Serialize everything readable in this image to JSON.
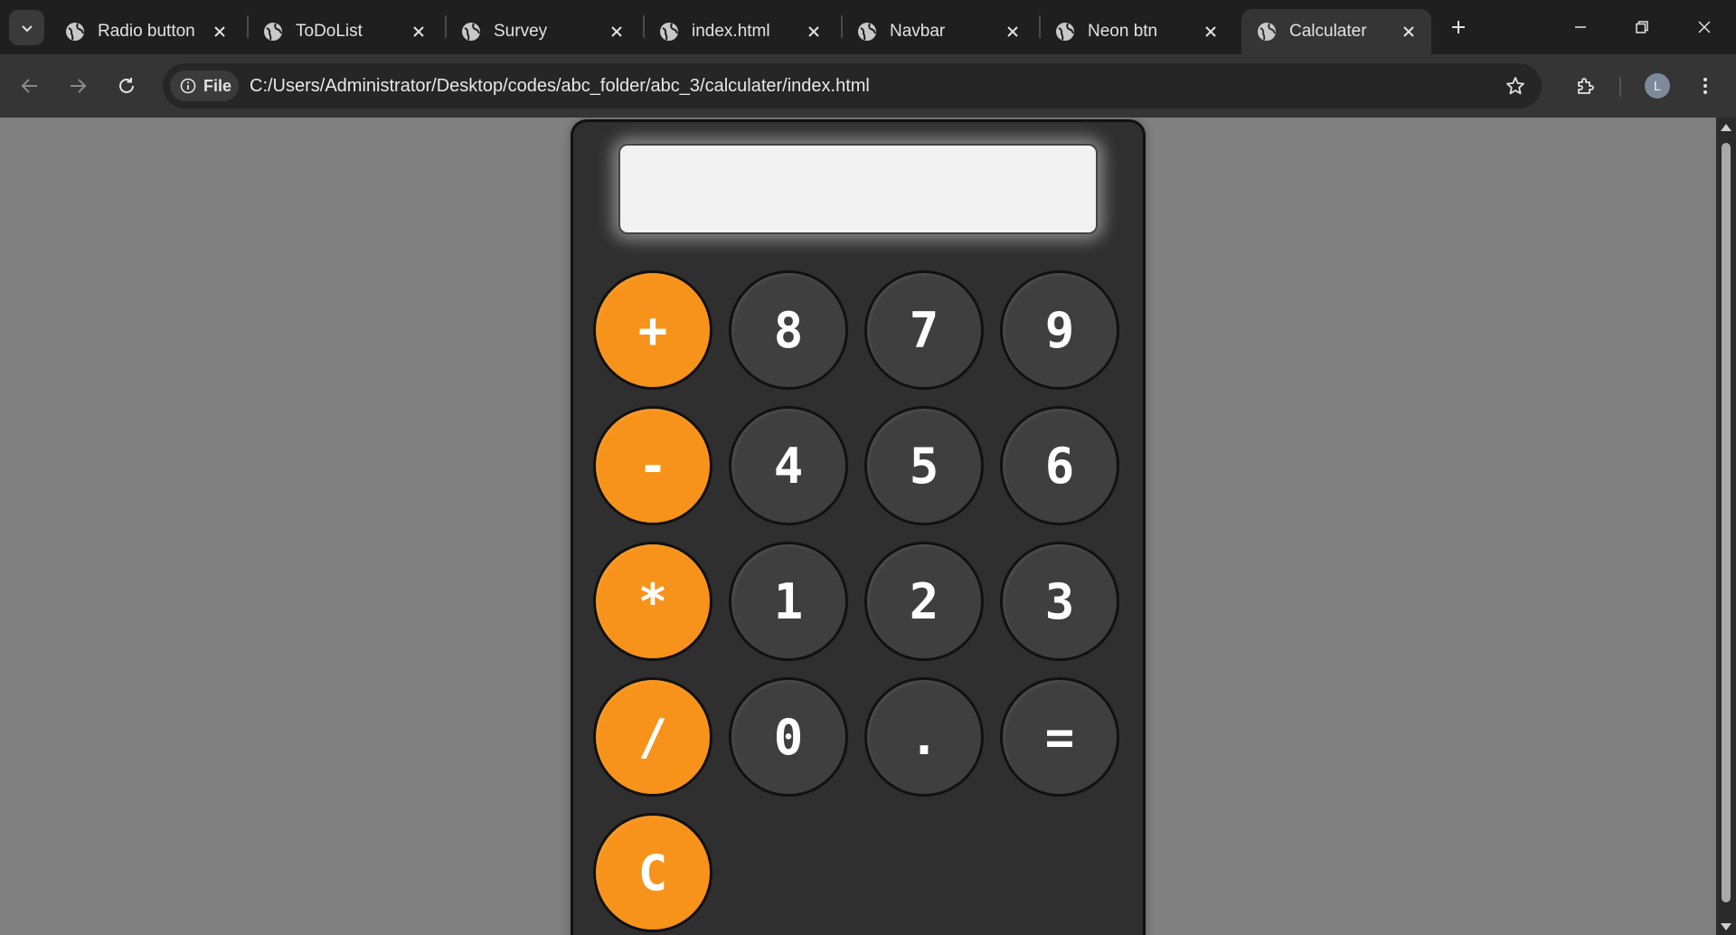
{
  "browser": {
    "tabs": [
      {
        "title": "Radio button",
        "active": false
      },
      {
        "title": "ToDoList",
        "active": false
      },
      {
        "title": "Survey",
        "active": false
      },
      {
        "title": "index.html",
        "active": false
      },
      {
        "title": "Navbar",
        "active": false
      },
      {
        "title": "Neon btn",
        "active": false
      },
      {
        "title": "Calculater",
        "active": true
      }
    ],
    "omnibox": {
      "scheme_chip": "File",
      "url": "C:/Users/Administrator/Desktop/codes/abc_folder/abc_3/calculater/index.html"
    },
    "profile_initial": "L"
  },
  "calculator": {
    "display_value": "",
    "keys": [
      {
        "label": "+",
        "kind": "operator"
      },
      {
        "label": "8",
        "kind": "digit"
      },
      {
        "label": "7",
        "kind": "digit"
      },
      {
        "label": "9",
        "kind": "digit"
      },
      {
        "label": "-",
        "kind": "operator"
      },
      {
        "label": "4",
        "kind": "digit"
      },
      {
        "label": "5",
        "kind": "digit"
      },
      {
        "label": "6",
        "kind": "digit"
      },
      {
        "label": "*",
        "kind": "operator"
      },
      {
        "label": "1",
        "kind": "digit"
      },
      {
        "label": "2",
        "kind": "digit"
      },
      {
        "label": "3",
        "kind": "digit"
      },
      {
        "label": "/",
        "kind": "operator"
      },
      {
        "label": "0",
        "kind": "digit"
      },
      {
        "label": ".",
        "kind": "digit"
      },
      {
        "label": "=",
        "kind": "equals"
      },
      {
        "label": "C",
        "kind": "clear"
      }
    ]
  },
  "colors": {
    "operator_key": "#f7931a",
    "number_key": "#3f3f3f",
    "calculator_body": "#2f2f2f",
    "page_background": "#808080"
  }
}
